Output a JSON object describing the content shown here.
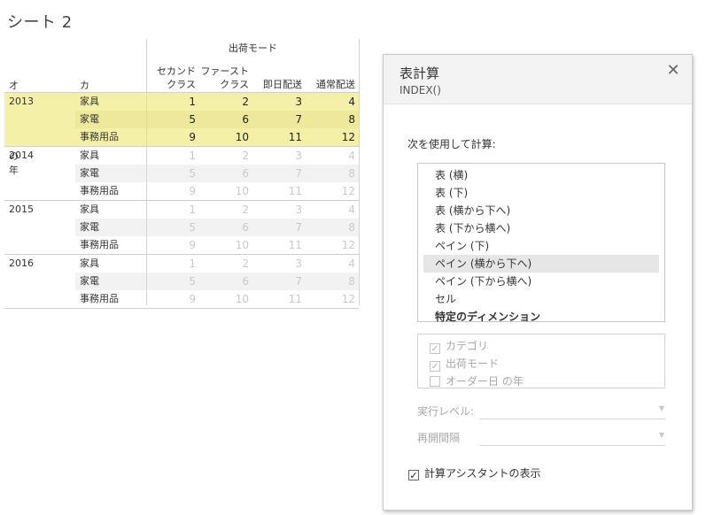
{
  "sheet": {
    "title": "シート 2"
  },
  "crosstab": {
    "column_group_header": "出荷モード",
    "row_headers": [
      "オーダー日 の年",
      "カテゴリ"
    ],
    "columns": [
      {
        "line1": "セカンド",
        "line2": "クラス"
      },
      {
        "line1": "ファースト",
        "line2": "クラス"
      },
      {
        "line1": "",
        "line2": "即日配送"
      },
      {
        "line1": "",
        "line2": "通常配送"
      }
    ],
    "years": [
      {
        "year": "2013",
        "highlighted": true,
        "rows": [
          {
            "category": "家具",
            "values": [
              "1",
              "2",
              "3",
              "4"
            ]
          },
          {
            "category": "家電",
            "values": [
              "5",
              "6",
              "7",
              "8"
            ]
          },
          {
            "category": "事務用品",
            "values": [
              "9",
              "10",
              "11",
              "12"
            ]
          }
        ]
      },
      {
        "year": "2014",
        "highlighted": false,
        "rows": [
          {
            "category": "家具",
            "values": [
              "1",
              "2",
              "3",
              "4"
            ]
          },
          {
            "category": "家電",
            "values": [
              "5",
              "6",
              "7",
              "8"
            ]
          },
          {
            "category": "事務用品",
            "values": [
              "9",
              "10",
              "11",
              "12"
            ]
          }
        ]
      },
      {
        "year": "2015",
        "highlighted": false,
        "rows": [
          {
            "category": "家具",
            "values": [
              "1",
              "2",
              "3",
              "4"
            ]
          },
          {
            "category": "家電",
            "values": [
              "5",
              "6",
              "7",
              "8"
            ]
          },
          {
            "category": "事務用品",
            "values": [
              "9",
              "10",
              "11",
              "12"
            ]
          }
        ]
      },
      {
        "year": "2016",
        "highlighted": false,
        "rows": [
          {
            "category": "家具",
            "values": [
              "1",
              "2",
              "3",
              "4"
            ]
          },
          {
            "category": "家電",
            "values": [
              "5",
              "6",
              "7",
              "8"
            ]
          },
          {
            "category": "事務用品",
            "values": [
              "9",
              "10",
              "11",
              "12"
            ]
          }
        ]
      }
    ],
    "highlight_color": "#f5f0a8"
  },
  "dialog": {
    "title": "表計算",
    "subtitle": "INDEX()",
    "close_icon": "close-icon",
    "compute_using_label": "次を使用して計算:",
    "compute_options": [
      {
        "label": "表 (横)",
        "selected": false,
        "bold": false
      },
      {
        "label": "表 (下)",
        "selected": false,
        "bold": false
      },
      {
        "label": "表 (横から下へ)",
        "selected": false,
        "bold": false
      },
      {
        "label": "表 (下から横へ)",
        "selected": false,
        "bold": false
      },
      {
        "label": "ペイン (下)",
        "selected": false,
        "bold": false
      },
      {
        "label": "ペイン (横から下へ)",
        "selected": true,
        "bold": false
      },
      {
        "label": "ペイン (下から横へ)",
        "selected": false,
        "bold": false
      },
      {
        "label": "セル",
        "selected": false,
        "bold": false
      },
      {
        "label": "特定のディメンション",
        "selected": false,
        "bold": true
      }
    ],
    "dimensions": [
      {
        "label": "カテゴリ",
        "checked": true
      },
      {
        "label": "出荷モード",
        "checked": true
      },
      {
        "label": "オーダー日 の年",
        "checked": false
      }
    ],
    "level_label": "実行レベル:",
    "level_value": "",
    "restart_label": "再開間隔",
    "restart_value": "",
    "assistant_label": "計算アシスタントの表示",
    "assistant_checked": true
  }
}
